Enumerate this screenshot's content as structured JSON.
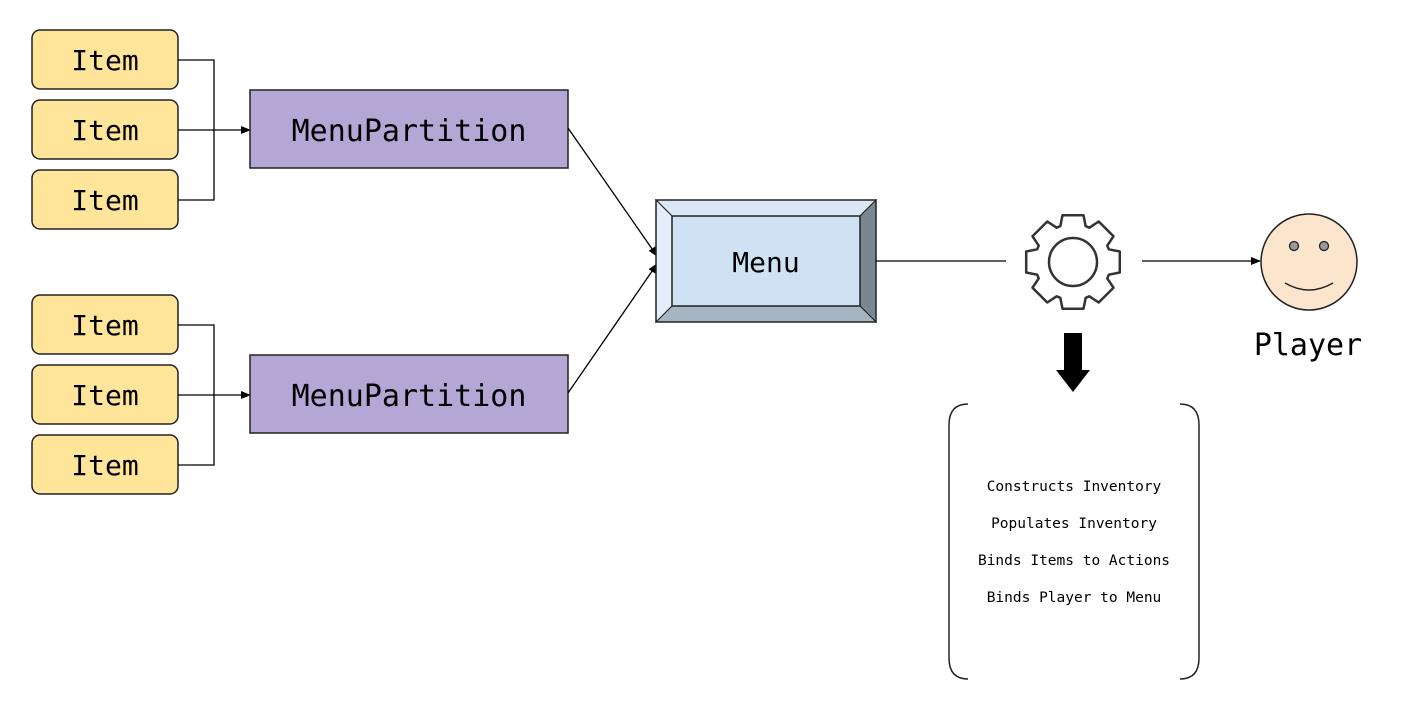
{
  "diagram": {
    "group_top": {
      "items": [
        "Item",
        "Item",
        "Item"
      ],
      "partition": "MenuPartition"
    },
    "group_bottom": {
      "items": [
        "Item",
        "Item",
        "Item"
      ],
      "partition": "MenuPartition"
    },
    "menu": "Menu",
    "processor_icon": "gear-icon",
    "player": {
      "label": "Player",
      "icon": "smiley-face-icon"
    },
    "responsibilities": [
      "Constructs Inventory",
      "Populates Inventory",
      "Binds Items to Actions",
      "Binds Player to Menu"
    ],
    "colors": {
      "item_fill": "#ffe599",
      "partition_fill": "#b4a7d6",
      "menu_fill": "#cfe2f3",
      "player_fill": "#fce5cd"
    }
  }
}
